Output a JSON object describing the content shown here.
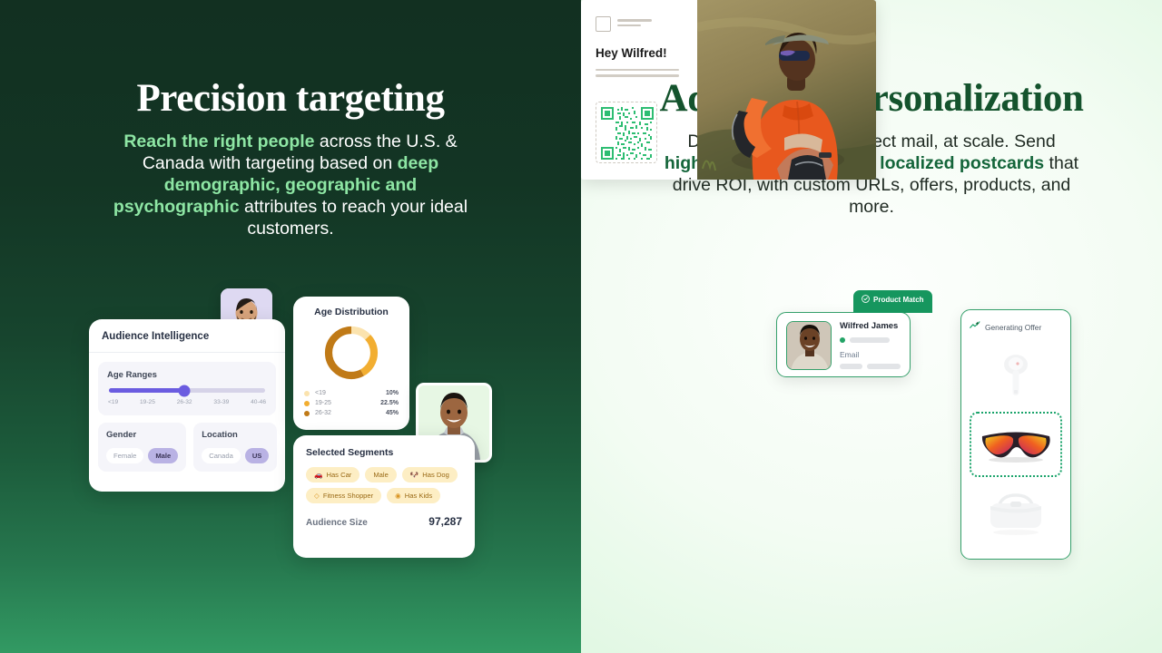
{
  "left_panel": {
    "title": "Precision targeting",
    "subtitle_parts": [
      {
        "text": "Reach the right people",
        "highlight": true
      },
      {
        "text": " across the U.S. & Canada with targeting based on ",
        "highlight": false
      },
      {
        "text": "deep demographic, geographic and psychographic",
        "highlight": true
      },
      {
        "text": " attributes to reach your ideal customers.",
        "highlight": false
      }
    ],
    "background_top": "#123021",
    "background_bottom": "#329a63",
    "highlight_color": "#8ee6a4"
  },
  "right_panel": {
    "title": "Advanced personalization",
    "subtitle_parts": [
      {
        "text": "Deliver personalized direct mail, at scale. Send ",
        "highlight": false
      },
      {
        "text": "highly individualized and localized postcards",
        "highlight": true
      },
      {
        "text": " that drive ROI, with custom URLs, offers, products, and more.",
        "highlight": false
      }
    ],
    "background": "#eafbea",
    "highlight_color": "#14653a"
  },
  "audience_card": {
    "header": "Audience Intelligence",
    "age_ranges": {
      "label": "Age Ranges",
      "ticks": [
        "<19",
        "19-25",
        "26-32",
        "33-39",
        "40-46"
      ],
      "selected": "26-32",
      "thumb_percent": 48,
      "accent_color": "#6b5ce0"
    },
    "gender": {
      "label": "Gender",
      "options": [
        {
          "label": "Female",
          "selected": false
        },
        {
          "label": "Male",
          "selected": true
        }
      ]
    },
    "location": {
      "label": "Location",
      "options": [
        {
          "label": "Canada",
          "selected": false
        },
        {
          "label": "US",
          "selected": true
        }
      ]
    }
  },
  "chart_data": {
    "type": "pie",
    "title": "Age Distribution",
    "categories": [
      "<19",
      "19-25",
      "26-32"
    ],
    "values": [
      10,
      22.5,
      45
    ],
    "value_labels": [
      "10%",
      "22.5%",
      "45%"
    ],
    "colors": [
      "#fbe3ae",
      "#f2ae31",
      "#c07a17"
    ],
    "donut": true,
    "legend_position": "bottom"
  },
  "segments_card": {
    "title": "Selected Segments",
    "segments": [
      {
        "label": "Has Car",
        "icon": "car-icon"
      },
      {
        "label": "Male",
        "icon": ""
      },
      {
        "label": "Has Dog",
        "icon": "dog-icon"
      },
      {
        "label": "Fitness Shopper",
        "icon": "diamond-icon"
      },
      {
        "label": "Has Kids",
        "icon": "baby-face-icon"
      }
    ],
    "audience_size_label": "Audience Size",
    "audience_size_value": "97,287"
  },
  "match_card": {
    "badge": "Product Match",
    "badge_icon": "check-circle-icon",
    "name": "Wilfred James",
    "email_label": "Email",
    "badge_color": "#16965e",
    "border_color": "#35a06b"
  },
  "offer_panel": {
    "title": "Generating Offer",
    "icon": "trend-sparkle-icon",
    "products": [
      {
        "name": "earbuds",
        "selected": false
      },
      {
        "name": "sunglasses",
        "selected": true
      },
      {
        "name": "crossbody-bag",
        "selected": false
      }
    ],
    "selection_color": "#19a36a"
  },
  "postcard": {
    "greeting": "Hey Wilfred!",
    "qr_color": "#2dbd72"
  }
}
